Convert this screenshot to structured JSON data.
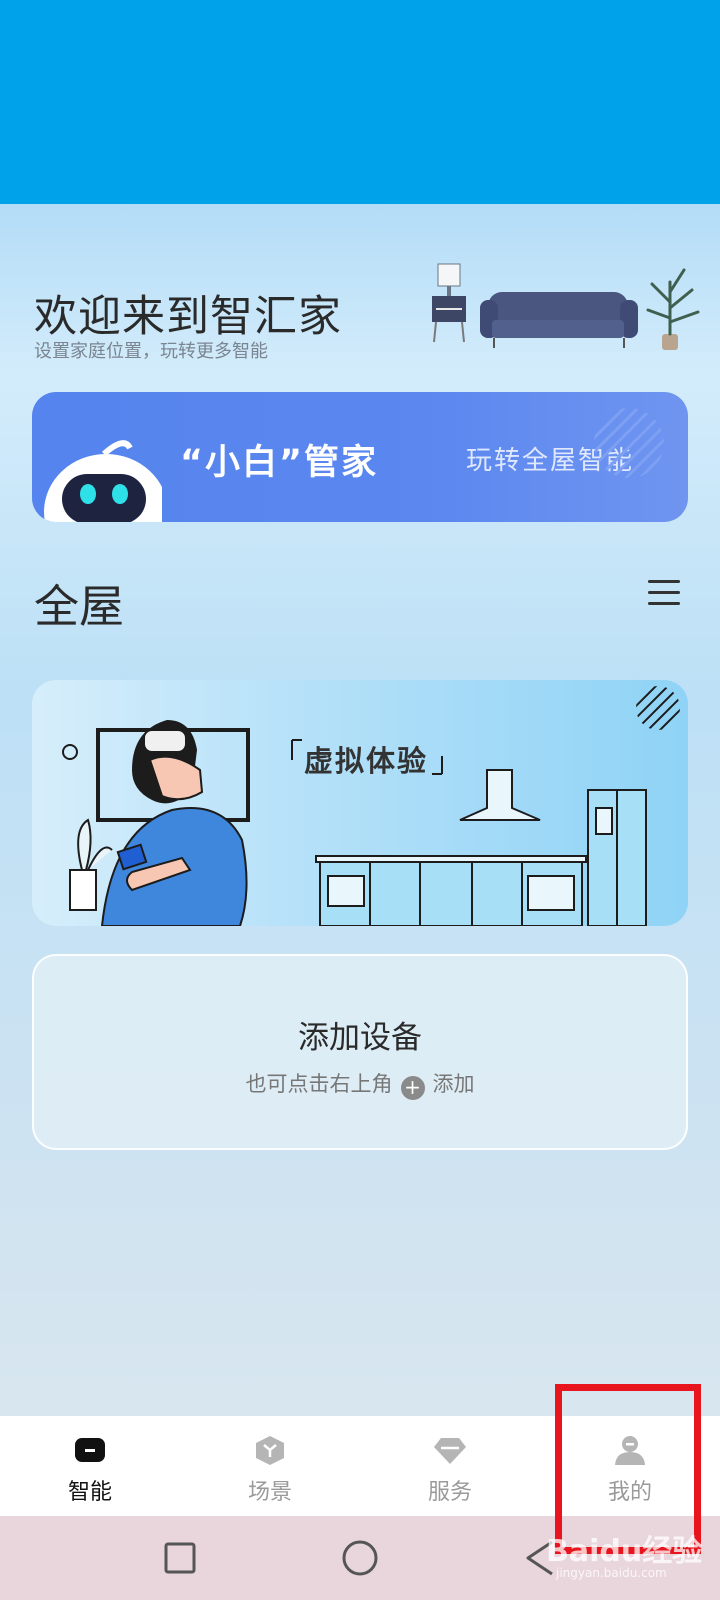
{
  "header": {
    "title": "欢迎来到智汇家",
    "subtitle": "设置家庭位置，玩转更多智能"
  },
  "butler_banner": {
    "title": "“小白”管家",
    "cta": "玩转全屋智能"
  },
  "section": {
    "title": "全屋"
  },
  "vr_card": {
    "label": "虚拟体验"
  },
  "add_device": {
    "title": "添加设备",
    "hint_before": "也可点击右上角",
    "plus_icon": "+",
    "hint_after": "添加"
  },
  "bottom_nav": {
    "items": [
      {
        "label": "智能",
        "icon": "robot-icon",
        "active": true
      },
      {
        "label": "场景",
        "icon": "cube-icon",
        "active": false
      },
      {
        "label": "服务",
        "icon": "diamond-icon",
        "active": false
      },
      {
        "label": "我的",
        "icon": "person-icon",
        "active": false
      }
    ]
  },
  "watermark": {
    "main": "Baidu经验",
    "sub": "jingyan.baidu.com"
  },
  "colors": {
    "status_bar": "#00a2ea",
    "banner_blue": "#5584ee",
    "highlight_red": "#e8141e"
  }
}
